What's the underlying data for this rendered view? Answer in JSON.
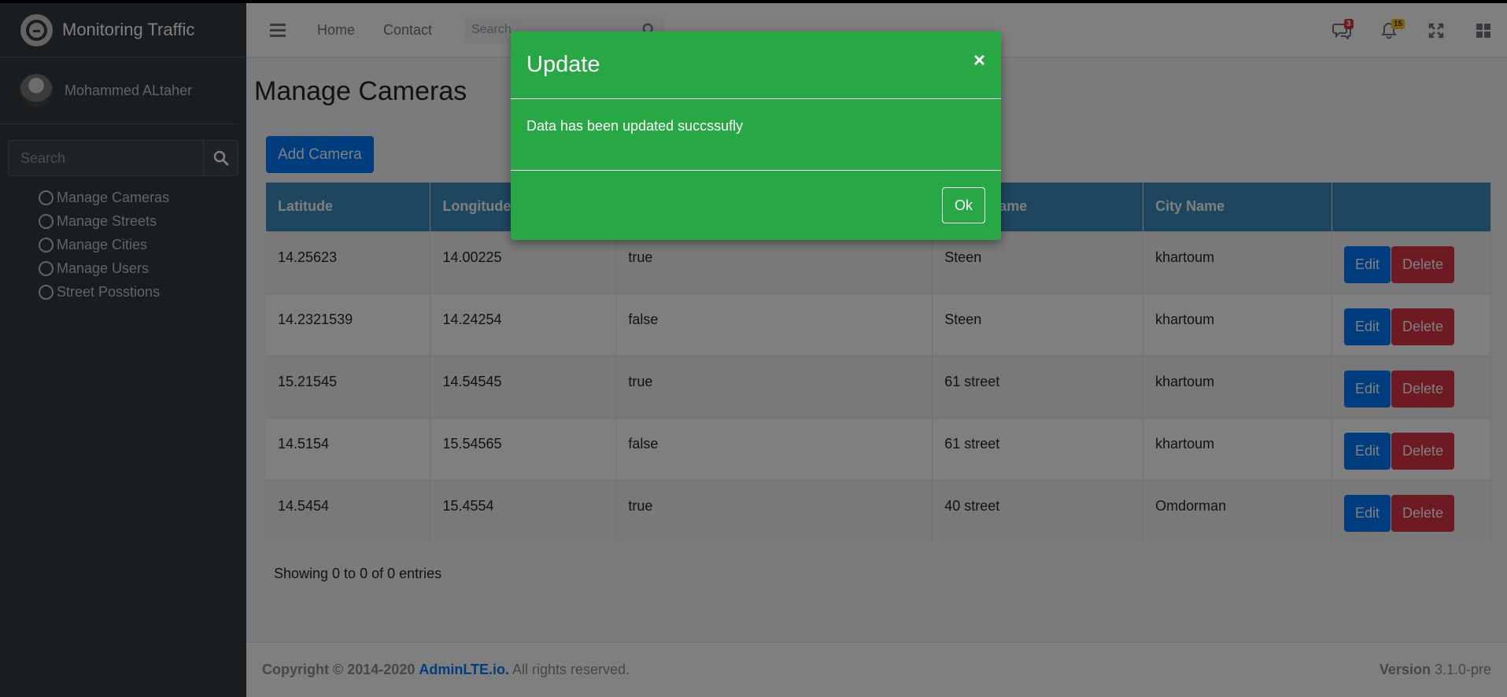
{
  "brand": {
    "title": "Monitoring Traffic"
  },
  "user": {
    "name": "Mohammed ALtaher"
  },
  "sidebar": {
    "search_placeholder": "Search",
    "items": [
      {
        "label": "Manage Cameras"
      },
      {
        "label": "Manage Streets"
      },
      {
        "label": "Manage Cities"
      },
      {
        "label": "Manage Users"
      },
      {
        "label": "Street Posstions"
      }
    ]
  },
  "topbar": {
    "home": "Home",
    "contact": "Contact",
    "search_placeholder": "Search",
    "messages_badge": "3",
    "notifications_badge": "15"
  },
  "page": {
    "title": "Manage Cameras",
    "add_button": "Add Camera",
    "table": {
      "headers": [
        "Latitude",
        "Longitude",
        "",
        "Street Name",
        "City Name",
        ""
      ],
      "rows": [
        [
          "14.25623",
          "14.00225",
          "true",
          "Steen",
          "khartoum"
        ],
        [
          "14.2321539",
          "14.24254",
          "false",
          "Steen",
          "khartoum"
        ],
        [
          "15.21545",
          "14.54545",
          "true",
          "61 street",
          "khartoum"
        ],
        [
          "14.5154",
          "15.54565",
          "false",
          "61 street",
          "khartoum"
        ],
        [
          "14.5454",
          "15.4554",
          "true",
          "40 street",
          "Omdorman"
        ]
      ],
      "edit_label": "Edit",
      "delete_label": "Delete"
    },
    "info": "Showing 0 to 0 of 0 entries"
  },
  "footer": {
    "copyright_prefix": "Copyright © 2014-2020",
    "link": "AdminLTE.io.",
    "suffix": "All rights reserved.",
    "version_label": "Version",
    "version": "3.1.0-pre"
  },
  "modal": {
    "title": "Update",
    "close": "×",
    "message": "Data has been updated succssufly",
    "ok": "Ok",
    "color": "#28a745"
  }
}
